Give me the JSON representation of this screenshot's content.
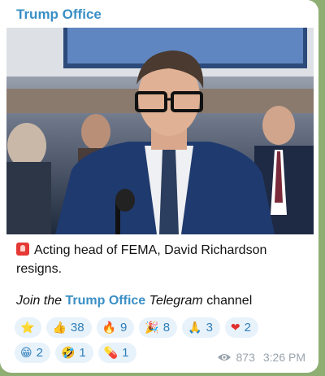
{
  "post": {
    "channel_name": "Trump Office",
    "caption_text": "Acting head of FEMA, David Richardson resigns.",
    "join_prefix": "Join the",
    "join_link": "Trump Office",
    "join_telegram": "Telegram",
    "join_suffix": "channel",
    "views": "873",
    "time": "3:26 PM"
  },
  "reactions": [
    {
      "emoji": "⭐",
      "count": "",
      "icon": "star-icon"
    },
    {
      "emoji": "👍",
      "count": "38",
      "icon": "thumbs-up-icon"
    },
    {
      "emoji": "🔥",
      "count": "9",
      "icon": "fire-icon"
    },
    {
      "emoji": "🎉",
      "count": "8",
      "icon": "party-popper-icon"
    },
    {
      "emoji": "🙏",
      "count": "3",
      "icon": "folded-hands-icon"
    },
    {
      "emoji": "❤",
      "count": "2",
      "icon": "heart-icon"
    },
    {
      "emoji": "😁",
      "count": "2",
      "icon": "grin-icon"
    },
    {
      "emoji": "🤣",
      "count": "1",
      "icon": "rofl-icon"
    },
    {
      "emoji": "💊",
      "count": "1",
      "icon": "pill-icon"
    }
  ],
  "colors": {
    "accent": "#3a8fc6",
    "reaction_bg": "#e8f2fb",
    "chat_background": "#8fae74"
  }
}
